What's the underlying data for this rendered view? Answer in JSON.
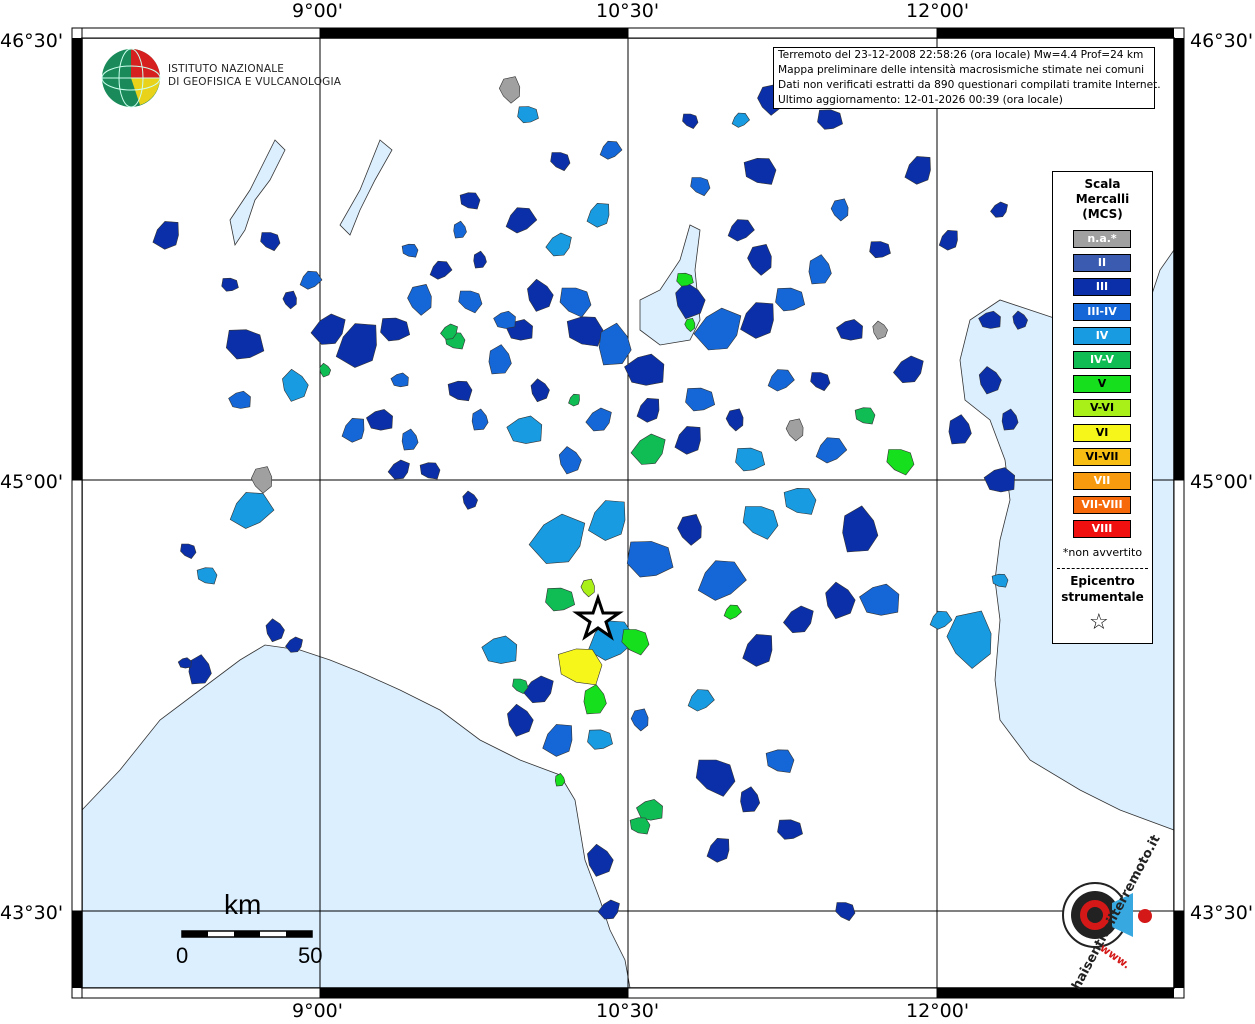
{
  "map": {
    "lon_labels": [
      "9°00'",
      "10°30'",
      "12°00'"
    ],
    "lat_labels": [
      "46°30'",
      "45°00'",
      "43°30'"
    ]
  },
  "institute": {
    "line1": "ISTITUTO NAZIONALE",
    "line2": "DI GEOFISICA E VULCANOLOGIA"
  },
  "info": {
    "line1": "Terremoto del 23-12-2008 22:58:26 (ora locale) Mw=4.4 Prof=24 km",
    "line2": "Mappa preliminare delle intensità macrosismiche stimate nei comuni",
    "line3": "Dati non verificati estratti da 890 questionari compilati tramite Internet.",
    "line4": "Ultimo aggiornamento: 12-01-2026 00:39 (ora locale)"
  },
  "legend": {
    "title1": "Scala",
    "title2": "Mercalli",
    "title3": "(MCS)",
    "items": [
      {
        "label": "n.a.*",
        "color": "#a0a0a0"
      },
      {
        "label": "II",
        "color": "#3a5bb0"
      },
      {
        "label": "III",
        "color": "#0a2fa8"
      },
      {
        "label": "III-IV",
        "color": "#1566d6"
      },
      {
        "label": "IV",
        "color": "#189be0"
      },
      {
        "label": "IV-V",
        "color": "#10bd55"
      },
      {
        "label": "V",
        "color": "#16e01e"
      },
      {
        "label": "V-VI",
        "color": "#a8f018"
      },
      {
        "label": "VI",
        "color": "#f6f61a"
      },
      {
        "label": "VI-VII",
        "color": "#f7bd12"
      },
      {
        "label": "VII",
        "color": "#f79a0e"
      },
      {
        "label": "VII-VIII",
        "color": "#f76a0c"
      },
      {
        "label": "VIII",
        "color": "#f01010"
      }
    ],
    "note": "*non avvertito",
    "epi1": "Epicentro",
    "epi2": "strumentale"
  },
  "scale": {
    "unit": "km",
    "min": "0",
    "max": "50"
  },
  "brand": {
    "text": "haisentitoilterremoto.it",
    "www": "www."
  }
}
